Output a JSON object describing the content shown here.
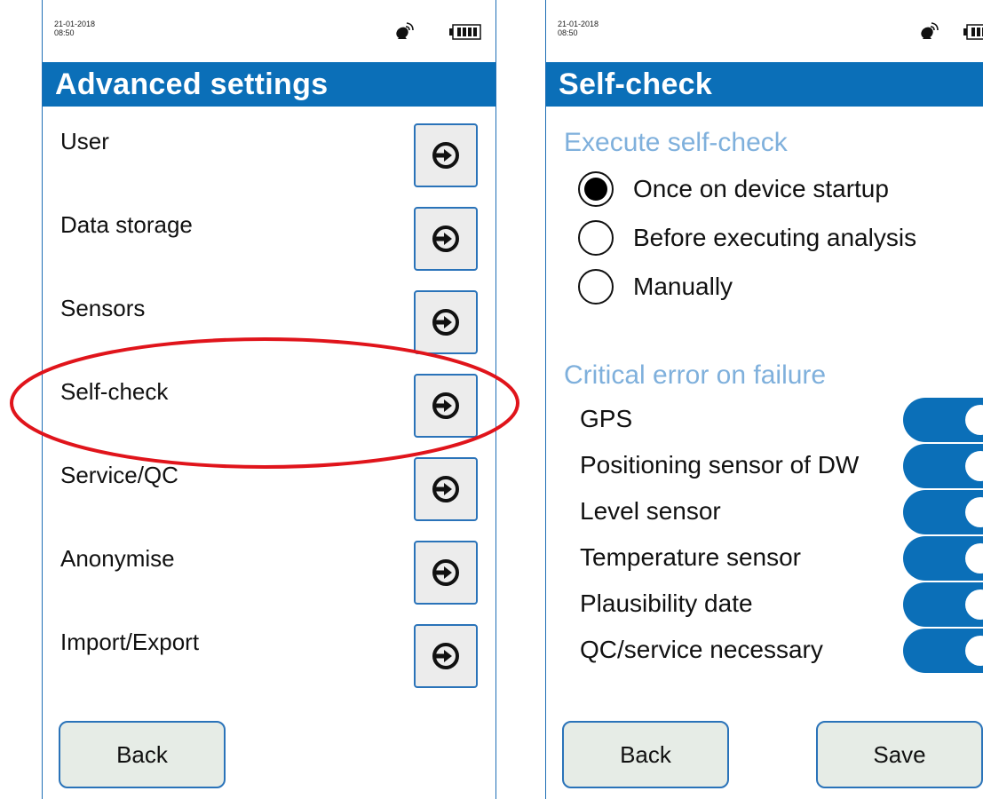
{
  "screen1": {
    "status": {
      "date": "21-01-2018",
      "time": "08:50"
    },
    "title": "Advanced settings",
    "menu": [
      {
        "label": "User"
      },
      {
        "label": "Data storage"
      },
      {
        "label": "Sensors"
      },
      {
        "label": "Self-check"
      },
      {
        "label": "Service/QC"
      },
      {
        "label": "Anonymise"
      },
      {
        "label": "Import/Export"
      }
    ],
    "back_label": "Back",
    "highlighted_item": "Self-check"
  },
  "screen2": {
    "status": {
      "date": "21-01-2018",
      "time": "08:50"
    },
    "title": "Self-check",
    "execute_section": {
      "title": "Execute self-check",
      "options": [
        {
          "label": "Once on device startup",
          "selected": true
        },
        {
          "label": "Before executing analysis",
          "selected": false
        },
        {
          "label": "Manually",
          "selected": false
        }
      ]
    },
    "critical_section": {
      "title": "Critical error on failure",
      "toggles": [
        {
          "label": "GPS",
          "on": true
        },
        {
          "label": "Positioning sensor of DW",
          "on": true
        },
        {
          "label": "Level sensor",
          "on": true
        },
        {
          "label": "Temperature sensor",
          "on": true
        },
        {
          "label": "Plausibility date",
          "on": true
        },
        {
          "label": "QC/service necessary",
          "on": true
        }
      ]
    },
    "back_label": "Back",
    "save_label": "Save"
  },
  "colors": {
    "header_blue": "#0b6fb8",
    "section_title": "#7fb0dc",
    "highlight": "#e0141b",
    "button_border": "#2a73b9"
  },
  "icons": [
    "satellite-icon",
    "battery-icon",
    "arrow-right-icon"
  ]
}
